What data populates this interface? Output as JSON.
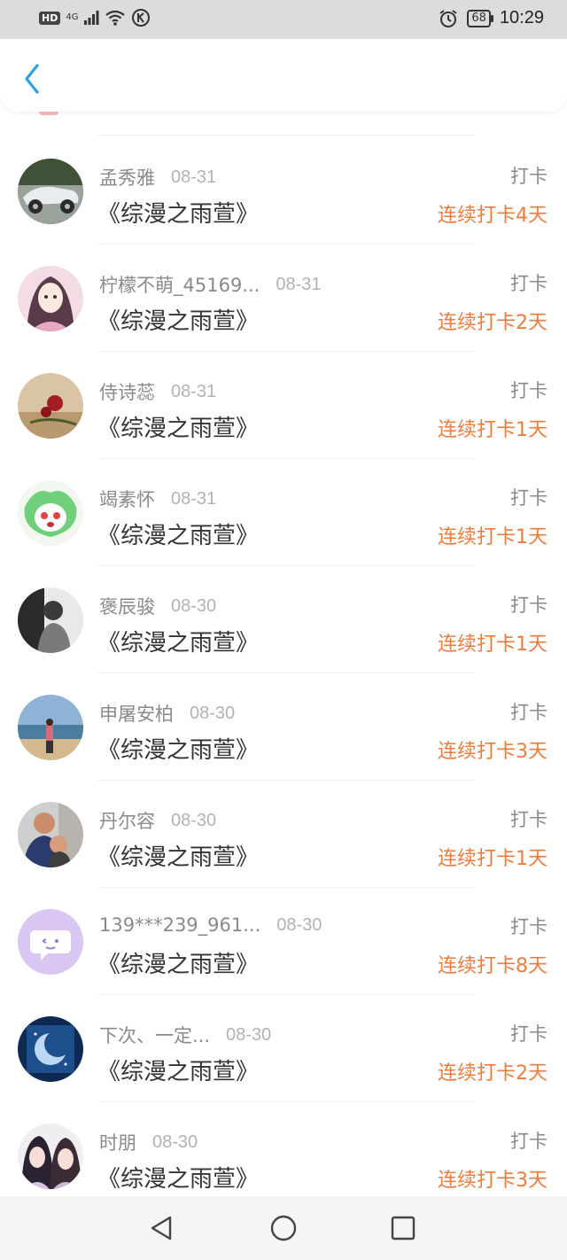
{
  "status_bar": {
    "network_label": "HD",
    "signal_label": "4G",
    "battery": "68",
    "time": "10:29"
  },
  "header": {
    "back_icon": "chevron-left-icon"
  },
  "items": [
    {
      "name": "孟秀雅",
      "date": "08-31",
      "title": "《综漫之雨萱》",
      "checkin": "打卡",
      "streak": "连续打卡4天"
    },
    {
      "name": "柠檬不萌_45169...",
      "date": "08-31",
      "title": "《综漫之雨萱》",
      "checkin": "打卡",
      "streak": "连续打卡2天"
    },
    {
      "name": "侍诗蕊",
      "date": "08-31",
      "title": "《综漫之雨萱》",
      "checkin": "打卡",
      "streak": "连续打卡1天"
    },
    {
      "name": "竭素怀",
      "date": "08-31",
      "title": "《综漫之雨萱》",
      "checkin": "打卡",
      "streak": "连续打卡1天"
    },
    {
      "name": "褒辰骏",
      "date": "08-30",
      "title": "《综漫之雨萱》",
      "checkin": "打卡",
      "streak": "连续打卡1天"
    },
    {
      "name": "申屠安柏",
      "date": "08-30",
      "title": "《综漫之雨萱》",
      "checkin": "打卡",
      "streak": "连续打卡3天"
    },
    {
      "name": "丹尔容",
      "date": "08-30",
      "title": "《综漫之雨萱》",
      "checkin": "打卡",
      "streak": "连续打卡1天"
    },
    {
      "name": "139***239_961...",
      "date": "08-30",
      "title": "《综漫之雨萱》",
      "checkin": "打卡",
      "streak": "连续打卡8天"
    },
    {
      "name": "下次、一定...",
      "date": "08-30",
      "title": "《综漫之雨萱》",
      "checkin": "打卡",
      "streak": "连续打卡2天"
    },
    {
      "name": "时朋",
      "date": "08-30",
      "title": "《综漫之雨萱》",
      "checkin": "打卡",
      "streak": "连续打卡3天"
    }
  ],
  "colors": {
    "accent_blue": "#2aa1e8",
    "streak_orange": "#f07b3a",
    "muted_text": "#8a8a8a"
  },
  "nav": {
    "back": "back-triangle-icon",
    "home": "home-circle-icon",
    "recents": "recents-square-icon"
  }
}
